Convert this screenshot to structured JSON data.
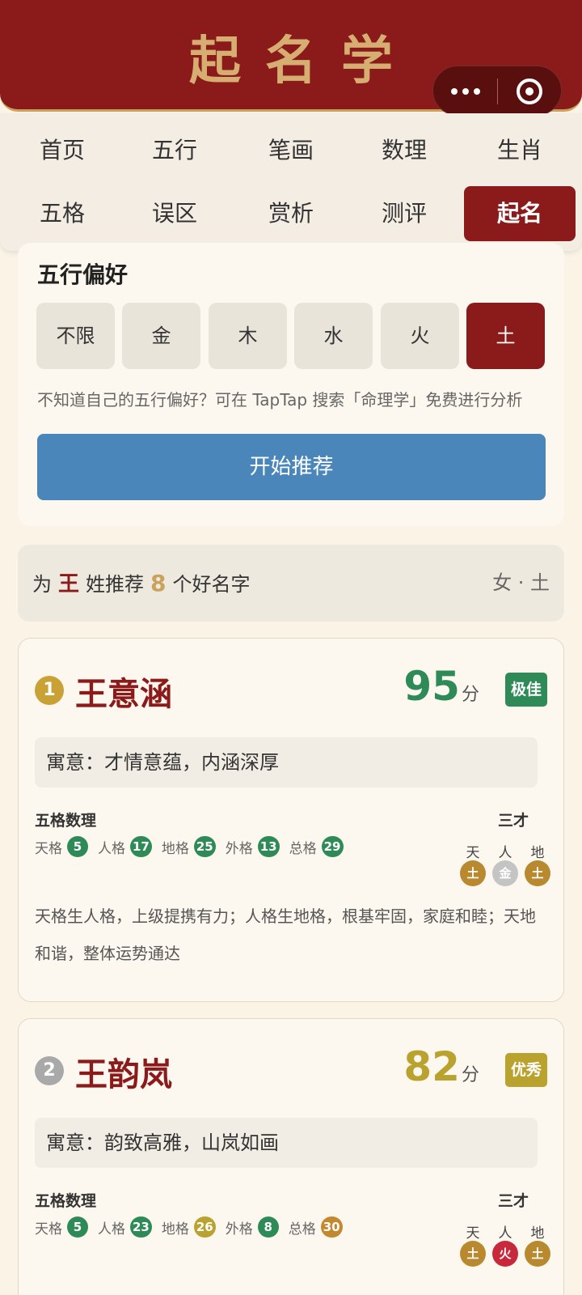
{
  "app": {
    "title": "起名学"
  },
  "capsule": {
    "more_icon": "more-dots-icon",
    "close_icon": "record-circle-icon"
  },
  "nav": {
    "row1": [
      "首页",
      "五行",
      "笔画",
      "数理",
      "生肖"
    ],
    "row2": [
      "五格",
      "误区",
      "赏析",
      "测评",
      "起名"
    ],
    "active": "起名"
  },
  "preference": {
    "title": "五行偏好",
    "options": [
      "不限",
      "金",
      "木",
      "水",
      "火",
      "土"
    ],
    "selected": "土",
    "hint": "不知道自己的五行偏好？可在 TapTap 搜索「命理学」免费进行分析",
    "start_button": "开始推荐"
  },
  "summary": {
    "prefix": "为",
    "surname": "王",
    "middle": "姓推荐",
    "count": "8",
    "suffix": "个好名字",
    "filter": "女 · 土"
  },
  "names": [
    {
      "rank": "1",
      "name": "王意涵",
      "score": "95",
      "score_unit": "分",
      "grade": "极佳",
      "grade_color": "#2e8b57",
      "score_color": "#2e8b57",
      "meaning": "寓意：才情意蕴，内涵深厚",
      "wuge_title": "五格数理",
      "wuge": [
        {
          "label": "天格",
          "value": "5",
          "color": "#2e8b57"
        },
        {
          "label": "人格",
          "value": "17",
          "color": "#2e8b57"
        },
        {
          "label": "地格",
          "value": "25",
          "color": "#2e8b57"
        },
        {
          "label": "外格",
          "value": "13",
          "color": "#2e8b57"
        },
        {
          "label": "总格",
          "value": "29",
          "color": "#2e8b57"
        }
      ],
      "sancai_title": "三才",
      "sancai": [
        {
          "label": "天",
          "value": "土",
          "color": "#b8892f"
        },
        {
          "label": "人",
          "value": "金",
          "color": "#c4c4c4"
        },
        {
          "label": "地",
          "value": "土",
          "color": "#b8892f"
        }
      ],
      "analysis": "天格生人格，上级提携有力；人格生地格，根基牢固，家庭和睦；天地和谐，整体运势通达"
    },
    {
      "rank": "2",
      "name": "王韵岚",
      "score": "82",
      "score_unit": "分",
      "grade": "优秀",
      "grade_color": "#b9a22e",
      "score_color": "#b9a22e",
      "meaning": "寓意：韵致高雅，山岚如画",
      "wuge_title": "五格数理",
      "wuge": [
        {
          "label": "天格",
          "value": "5",
          "color": "#2e8b57"
        },
        {
          "label": "人格",
          "value": "23",
          "color": "#2e8b57"
        },
        {
          "label": "地格",
          "value": "26",
          "color": "#b9a22e"
        },
        {
          "label": "外格",
          "value": "8",
          "color": "#2e8b57"
        },
        {
          "label": "总格",
          "value": "30",
          "color": "#c4892f"
        }
      ],
      "sancai_title": "三才",
      "sancai": [
        {
          "label": "天",
          "value": "土",
          "color": "#b8892f"
        },
        {
          "label": "人",
          "value": "火",
          "color": "#c8283c"
        },
        {
          "label": "地",
          "value": "土",
          "color": "#b8892f"
        }
      ]
    }
  ]
}
